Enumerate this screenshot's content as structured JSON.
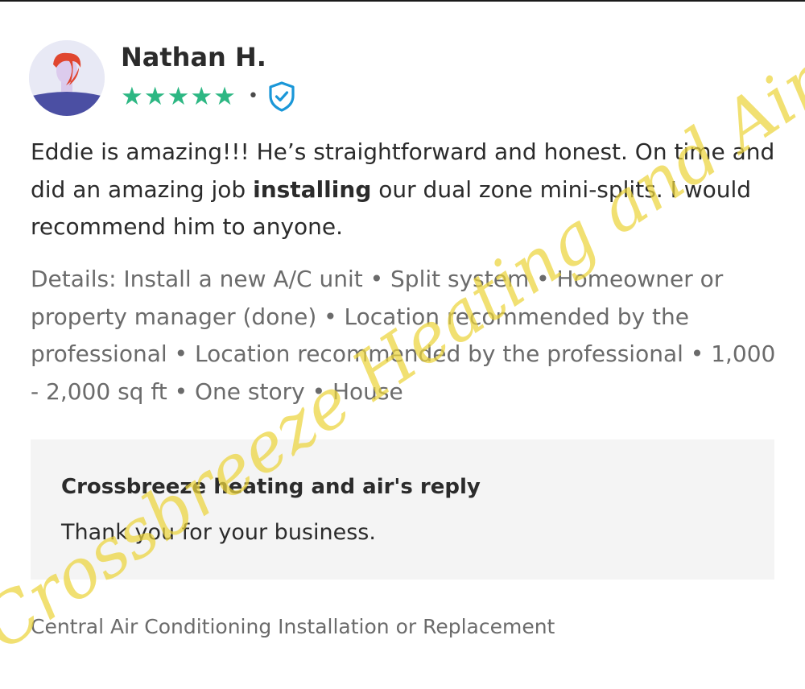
{
  "review": {
    "reviewer_name": "Nathan H.",
    "rating_stars": "★★★★★",
    "rating_value": 5,
    "rating_max": 5,
    "separator": "•",
    "text_part1": "Eddie is amazing!!! He’s straightforward and honest. On time and did an amazing job ",
    "text_bold": "installing",
    "text_part2": " our dual zone mini-splits. I would recommend him to anyone.",
    "details": "Details: Install a new A/C unit • Split system • Homeowner or property manager (done) • Location recommended by the professional • Location recommended by the professional • 1,000 - 2,000 sq ft • One story • House"
  },
  "reply": {
    "title": "Crossbreeze heating and air's reply",
    "body": "Thank you for your business."
  },
  "footer": {
    "service_category": "Central Air Conditioning Installation or Replacement"
  },
  "watermark": {
    "text": "Crossbreeze Heating and Air"
  },
  "icons": {
    "avatar": "person-avatar-icon",
    "verified": "verified-shield-icon"
  },
  "colors": {
    "stars": "#2db783",
    "verified_badge": "#1a97d8",
    "reply_background": "#f4f4f4",
    "watermark": "#ecd43c",
    "details_text": "#6b6b6b",
    "body_text": "#2b2b2b"
  }
}
